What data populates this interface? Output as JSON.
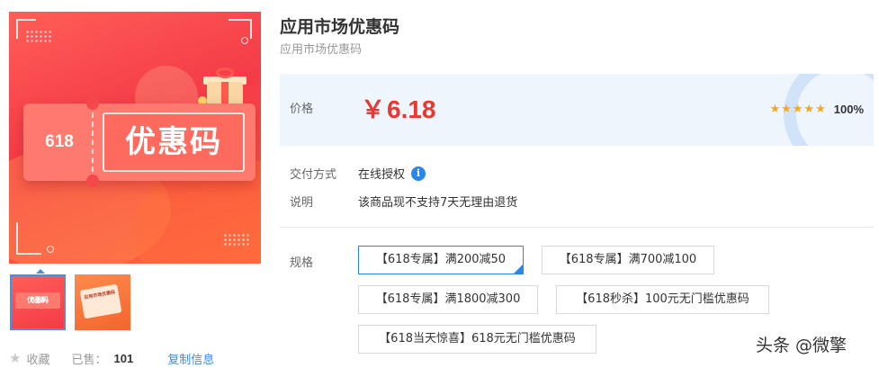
{
  "gallery": {
    "main_image": {
      "number_text": "618",
      "headline_text": "优惠码"
    },
    "thumbnails": [
      {
        "number_text": "618",
        "headline_text": "优惠码",
        "selected": true
      },
      {
        "card_text": "应用市场优惠码",
        "selected": false
      }
    ]
  },
  "meta": {
    "favorite_label": "收藏",
    "sold_label": "已售：",
    "sold_count": "101",
    "copy_label": "复制信息"
  },
  "product": {
    "title": "应用市场优惠码",
    "subtitle": "应用市场优惠码"
  },
  "price": {
    "label": "价格",
    "currency": "￥",
    "amount": "6.18",
    "rating_stars": 5,
    "rating_pct": "100%"
  },
  "delivery": {
    "label": "交付方式",
    "value": "在线授权"
  },
  "notes": {
    "label": "说明",
    "value": "该商品现不支持7天无理由退货"
  },
  "specs": {
    "label": "规格",
    "options": [
      {
        "label": "【618专属】满200减50",
        "selected": true
      },
      {
        "label": "【618专属】满700减100",
        "selected": false
      },
      {
        "label": "【618专属】满1800减300",
        "selected": false
      },
      {
        "label": "【618秒杀】100元无门槛优惠码",
        "selected": false
      },
      {
        "label": "【618当天惊喜】618元无门槛优惠码",
        "selected": false
      }
    ]
  },
  "watermark": "头条 @微擎",
  "colors": {
    "accent_blue": "#2a86e8",
    "price_red": "#e8382f",
    "star_orange": "#f5a623",
    "price_panel_bg": "#eef5fd"
  }
}
